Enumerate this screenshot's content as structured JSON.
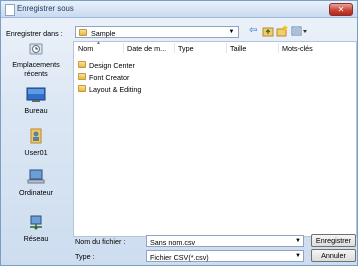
{
  "window": {
    "title": "Enregistrer sous",
    "close_icon": "close-icon"
  },
  "lookin": {
    "label": "Enregistrer dans :",
    "value": "Sample"
  },
  "places": [
    {
      "label": "Emplacements récents",
      "icon": "recent-places-icon"
    },
    {
      "label": "Bureau",
      "icon": "desktop-icon"
    },
    {
      "label": "User01",
      "icon": "user-folder-icon"
    },
    {
      "label": "Ordinateur",
      "icon": "computer-icon"
    },
    {
      "label": "Réseau",
      "icon": "network-icon"
    }
  ],
  "columns": [
    "Nom",
    "Date de m...",
    "Type",
    "Taille",
    "Mots-clés"
  ],
  "files": [
    {
      "name": "Design Center"
    },
    {
      "name": "Font Creator"
    },
    {
      "name": "Layout & Editing"
    }
  ],
  "filename": {
    "label": "Nom du fichier :",
    "value": "Sans nom.csv"
  },
  "filetype": {
    "label": "Type :",
    "value": "Fichier CSV(*.csv)"
  },
  "buttons": {
    "save": "Enregistrer",
    "cancel": "Annuler"
  }
}
